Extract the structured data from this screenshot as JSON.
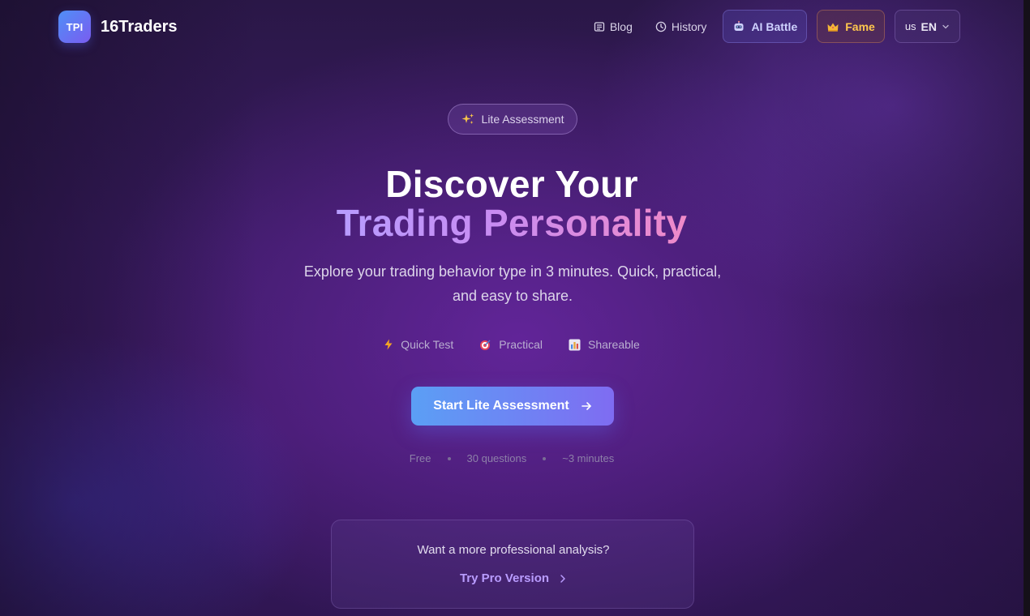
{
  "header": {
    "logo_text": "TPI",
    "brand": "16Traders",
    "nav": {
      "blog": {
        "label": "Blog",
        "icon": "newspaper-icon"
      },
      "history": {
        "label": "History",
        "icon": "clock-icon"
      },
      "ai_battle": {
        "label": "AI Battle",
        "icon": "robot-icon"
      },
      "fame": {
        "label": "Fame",
        "icon": "crown-icon"
      },
      "language": {
        "flag": "us",
        "code": "EN",
        "icon": "chevron-down-icon"
      }
    }
  },
  "hero": {
    "badge": {
      "icon": "sparkles-icon",
      "label": "Lite Assessment"
    },
    "title_line1": "Discover Your",
    "title_line2": "Trading Personality",
    "subtitle": "Explore your trading behavior type in 3 minutes. Quick, practical, and easy to share.",
    "features": [
      {
        "icon": "lightning-icon",
        "label": "Quick Test"
      },
      {
        "icon": "target-icon",
        "label": "Practical"
      },
      {
        "icon": "bar-chart-icon",
        "label": "Shareable"
      }
    ],
    "cta": {
      "label": "Start Lite Assessment",
      "icon": "arrow-right-icon"
    },
    "meta": [
      "Free",
      "30 questions",
      "~3 minutes"
    ]
  },
  "pro_card": {
    "question": "Want a more professional analysis?",
    "link_label": "Try Pro Version",
    "link_icon": "chevron-right-icon"
  },
  "colors": {
    "background": "#3a1b62",
    "cta_start": "#5b9ff5",
    "cta_end": "#7f6cf2",
    "title_gradient_start": "#b79cff",
    "title_gradient_end": "#f08ac8",
    "fame_text": "#ffc74d"
  }
}
